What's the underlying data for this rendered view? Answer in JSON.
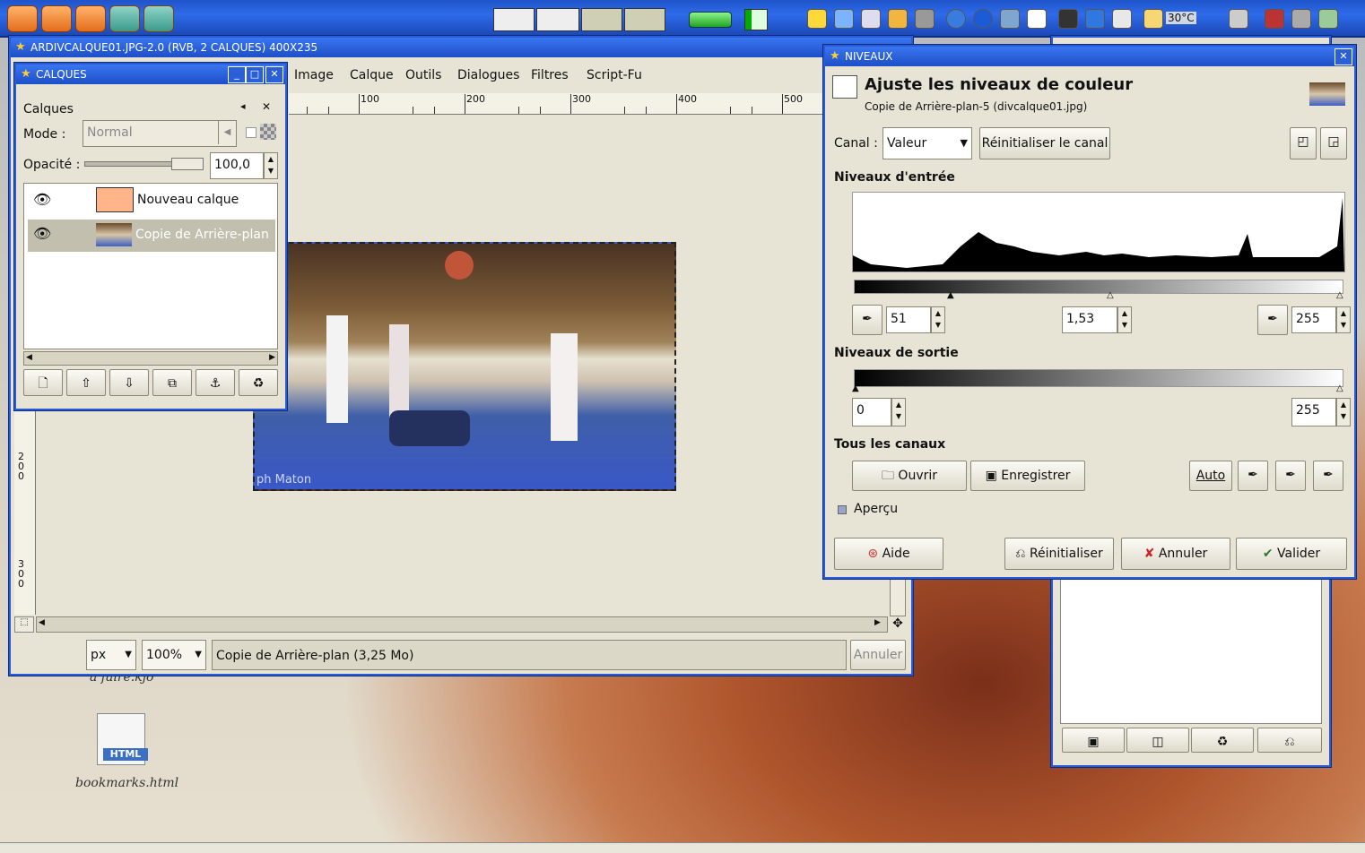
{
  "colors": {
    "accent": "#2a5bd7",
    "title": "#1d4fc7",
    "window_bg": "#e7e3d5",
    "layer_color": "#ffb48a"
  },
  "taskbar": {
    "weather": "30°C"
  },
  "image_window": {
    "title": "ARDIVCALQUE01.JPG-2.0 (RVB, 2 CALQUES) 400X235",
    "menu": [
      "Image",
      "Calque",
      "Outils",
      "Dialogues",
      "Filtres",
      "Script-Fu"
    ],
    "ruler_h": [
      "100",
      "200",
      "300",
      "400",
      "500"
    ],
    "ruler_v": [
      "200",
      "300"
    ],
    "unit": "px",
    "zoom": "100%",
    "status": "Copie de Arrière-plan (3,25 Mo)",
    "cancel": "Annuler",
    "watermark": "ph Maton"
  },
  "layers_dialog": {
    "title": "CALQUES",
    "tab_label": "Calques",
    "mode_label": "Mode :",
    "mode_value": "Normal",
    "opacity_label": "Opacité :",
    "opacity_value": "100,0",
    "layers": [
      {
        "name": "Nouveau calque"
      },
      {
        "name": "Copie de Arrière-plan"
      }
    ]
  },
  "levels_dialog": {
    "title": "NIVEAUX",
    "heading": "Ajuste les niveaux de couleur",
    "subheading": "Copie de Arrière-plan-5 (divcalque01.jpg)",
    "channel_label": "Canal :",
    "channel_value": "Valeur",
    "reset_channel": "Réinitialiser le canal",
    "input_levels": "Niveaux d'entrée",
    "input_low": "51",
    "input_gamma": "1,53",
    "input_high": "255",
    "output_levels": "Niveaux de sortie",
    "output_low": "0",
    "output_high": "255",
    "all_channels": "Tous les canaux",
    "open": "Ouvrir",
    "save": "Enregistrer",
    "auto": "Auto",
    "preview": "Aperçu",
    "help": "Aide",
    "reset": "Réinitialiser",
    "cancel": "Annuler",
    "ok": "Valider"
  },
  "desktop": {
    "icon1": "a faire.kjo",
    "icon2": "bookmarks.html",
    "icon2_badge": "HTML"
  }
}
